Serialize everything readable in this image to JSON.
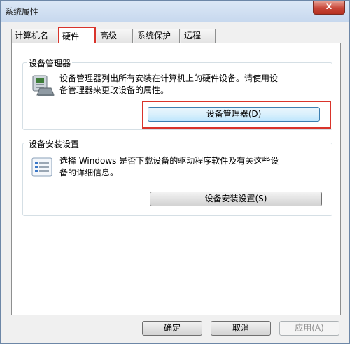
{
  "window": {
    "title": "系统属性",
    "close_label": "x"
  },
  "tabs": [
    {
      "label": "计算机名"
    },
    {
      "label": "硬件"
    },
    {
      "label": "高级"
    },
    {
      "label": "系统保护"
    },
    {
      "label": "远程"
    }
  ],
  "device_manager": {
    "title": "设备管理器",
    "description_line1": "设备管理器列出所有安装在计算机上的硬件设备。请使用设",
    "description_line2": "备管理器来更改设备的属性。",
    "button_label": "设备管理器(D)",
    "icon": "computer-device-icon"
  },
  "device_install": {
    "title": "设备安装设置",
    "description_line1": "选择 Windows 是否下载设备的驱动程序软件及有关这些设",
    "description_line2": "备的详细信息。",
    "button_label": "设备安装设置(S)",
    "icon": "checklist-icon"
  },
  "footer": {
    "ok_label": "确定",
    "cancel_label": "取消",
    "apply_label": "应用(A)"
  },
  "colors": {
    "highlight": "#d9342b"
  }
}
